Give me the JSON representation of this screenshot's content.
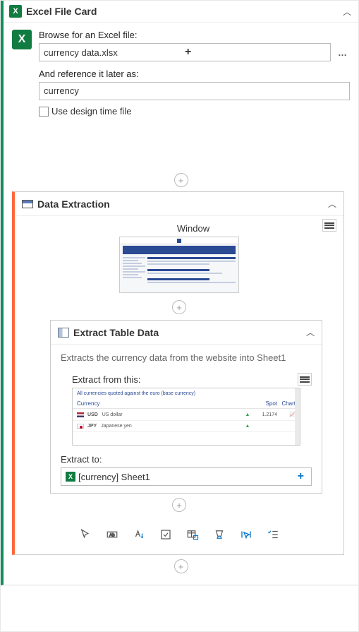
{
  "excelCard": {
    "title": "Excel File Card",
    "browseLabel": "Browse for an Excel file:",
    "fileName": "currency data.xlsx",
    "referenceLabel": "And reference it later as:",
    "referenceValue": "currency",
    "designTimeLabel": "Use design time file",
    "designTimeChecked": false
  },
  "dataExtraction": {
    "title": "Data Extraction",
    "windowLabel": "Window"
  },
  "extractTable": {
    "title": "Extract Table Data",
    "description": "Extracts the currency data from the website into Sheet1",
    "extractFromLabel": "Extract from this:",
    "extractToLabel": "Extract to:",
    "extractToValue": "[currency] Sheet1",
    "tablePreview": {
      "caption": "All currencies quoted against the euro (base currency)",
      "headers": {
        "c1": "Currency",
        "c2": "",
        "c3": "Spot",
        "c4": "Chart"
      },
      "rows": [
        {
          "flag": "us",
          "code": "USD",
          "name": "US dollar",
          "arrow": "▲",
          "spot": "1.2174",
          "chart": "📈"
        },
        {
          "flag": "jp",
          "code": "JPY",
          "name": "Japanese yen",
          "arrow": "▲",
          "spot": "",
          "chart": ""
        }
      ]
    }
  },
  "icons": {
    "excel": "X",
    "plus": "+",
    "ellipsis": "…",
    "chevronUp": "︿",
    "addCircle": "+"
  }
}
